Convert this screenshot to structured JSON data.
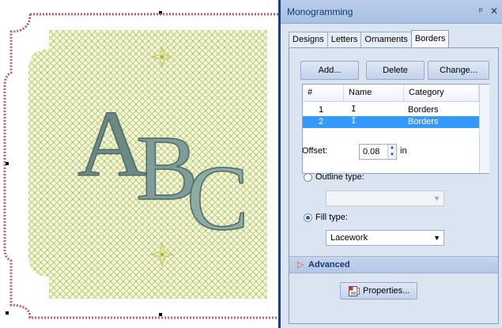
{
  "canvas": {
    "design_text": "ABC"
  },
  "panel": {
    "title": "Monogramming",
    "pin_icon": "pin-icon",
    "close_icon": "close-icon",
    "tabs": [
      {
        "label": "Designs",
        "active": false
      },
      {
        "label": "Letters",
        "active": false
      },
      {
        "label": "Ornaments",
        "active": false
      },
      {
        "label": "Borders",
        "active": true
      }
    ],
    "buttons": {
      "add": "Add...",
      "delete": "Delete",
      "change": "Change..."
    },
    "table": {
      "headers": [
        "#",
        "Name",
        "Category"
      ],
      "rows": [
        {
          "num": "1",
          "name": "I",
          "category": "Borders",
          "selected": false
        },
        {
          "num": "2",
          "name": "I",
          "category": "Borders",
          "selected": true
        }
      ]
    },
    "offset": {
      "label": "Offset:",
      "value": "0.08",
      "unit": "in"
    },
    "outline": {
      "label": "Outline type:",
      "checked": false,
      "value": ""
    },
    "fill": {
      "label": "Fill type:",
      "checked": true,
      "value": "Lacework"
    },
    "advanced": {
      "label": "Advanced"
    },
    "properties_button": "Properties..."
  }
}
